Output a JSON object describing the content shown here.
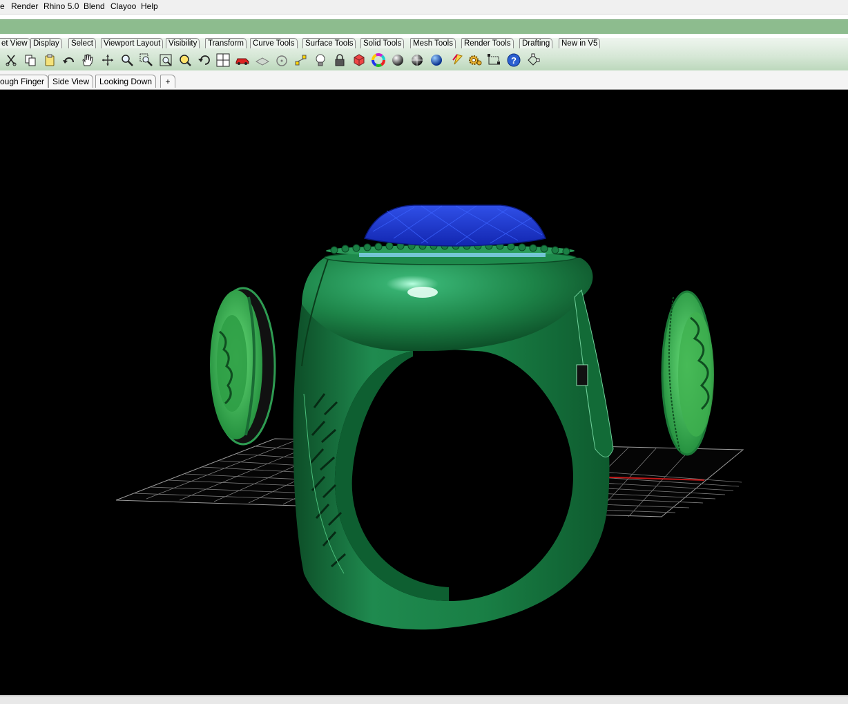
{
  "menu": {
    "items": [
      "e",
      "Render",
      "Rhino 5.0",
      "Blend",
      "Clayoo",
      "Help"
    ]
  },
  "toolbar_tabs": [
    "et View",
    "Display",
    "Select",
    "Viewport Layout",
    "Visibility",
    "Transform",
    "Curve Tools",
    "Surface Tools",
    "Solid Tools",
    "Mesh Tools",
    "Render Tools",
    "Drafting",
    "New in V5"
  ],
  "toolbar_icons": [
    "cut-icon",
    "copy-icon",
    "paste-icon",
    "undo-icon",
    "pan-hand-icon",
    "rotate-view-icon",
    "zoom-dynamic-icon",
    "zoom-window-icon",
    "zoom-extents-icon",
    "zoom-selected-icon",
    "undo-view-icon",
    "four-viewports-icon",
    "car-icon",
    "layer-icon",
    "circle-icon",
    "points-icon",
    "lightbulb-icon",
    "lock-icon",
    "shaded-icon",
    "color-wheel-icon",
    "render-sphere-icon",
    "rendered-sphere-icon",
    "blue-sphere-icon",
    "spotlight-icon",
    "gear-icon",
    "dimension-icon",
    "help-icon",
    "cursor-icon"
  ],
  "viewport_tabs": [
    "ough Finger",
    "Side View",
    "Looking Down"
  ],
  "add_viewport_glyph": "+",
  "colors": {
    "command_bar": "#8dbc8e",
    "metal_green": "#1f8a4f",
    "gem_blue": "#1f3fd0",
    "grid": "#9a9a9a",
    "axis_x": "#c01818",
    "axis_y": "#2aa0c8"
  }
}
